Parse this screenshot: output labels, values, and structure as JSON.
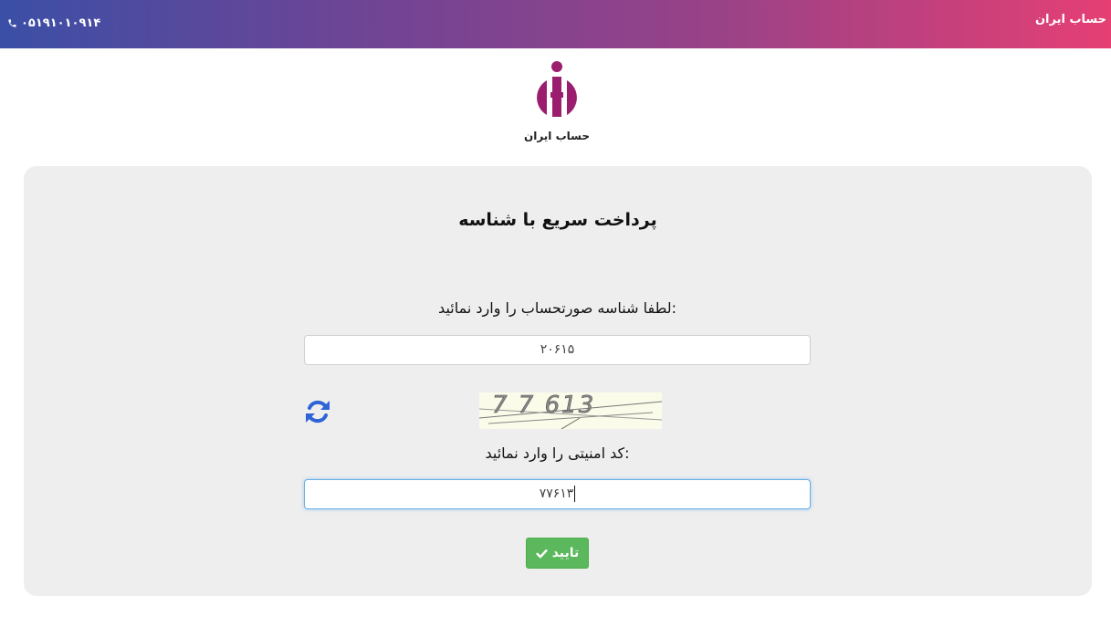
{
  "header": {
    "phone": "۰۵۱۹۱۰۱۰۹۱۴",
    "brand": "حساب ایران",
    "gradient_start": "#3b4fa6",
    "gradient_end": "#e53f74"
  },
  "logo": {
    "caption": "حساب ایران",
    "color": "#9b1e6e"
  },
  "form": {
    "title": "پرداخت سریع با شناسه",
    "invoice_label": "لطفا شناسه صورتحساب را وارد نمائید:",
    "invoice_value": "۲۰۶۱۵",
    "captcha_text": "7 7 613",
    "captcha_label": "کد امنیتی را وارد نمائید:",
    "captcha_value": "۷۷۶۱۳",
    "submit_label": "تایید",
    "submit_icon": "check-icon",
    "refresh_icon": "refresh-icon"
  }
}
